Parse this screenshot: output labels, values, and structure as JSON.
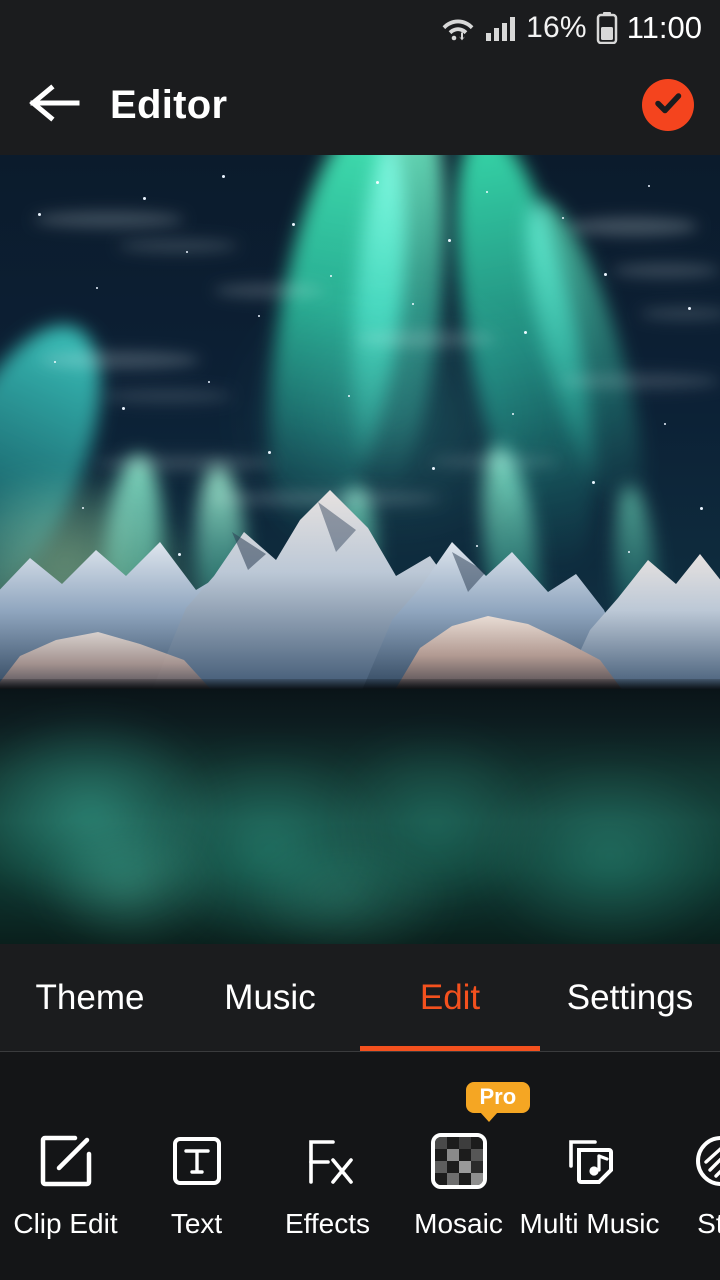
{
  "status_bar": {
    "wifi_icon": "wifi-arrows-icon",
    "signal_icon": "cellular-signal-icon",
    "battery_percent": "16%",
    "battery_icon": "battery-icon",
    "clock": "11:00"
  },
  "app_bar": {
    "back_icon": "arrow-left-icon",
    "title": "Editor",
    "done_icon": "check-circle-icon",
    "done_color": "#f4441e"
  },
  "preview": {
    "scene": "aurora-borealis-over-snowy-mountains-and-lake"
  },
  "tabs": {
    "active_color": "#f4511e",
    "items": [
      {
        "label": "Theme",
        "active": false
      },
      {
        "label": "Music",
        "active": false
      },
      {
        "label": "Edit",
        "active": true
      },
      {
        "label": "Settings",
        "active": false
      }
    ]
  },
  "tools": {
    "items": [
      {
        "label": "Clip Edit",
        "icon": "square-pencil-icon",
        "badge": null
      },
      {
        "label": "Text",
        "icon": "text-box-icon",
        "badge": null
      },
      {
        "label": "Effects",
        "icon": "fx-icon",
        "badge": null
      },
      {
        "label": "Mosaic",
        "icon": "mosaic-grid-icon",
        "badge": "Pro"
      },
      {
        "label": "Multi Music",
        "icon": "music-stack-icon",
        "badge": null
      },
      {
        "label": "Stic",
        "icon": "sticker-circle-icon",
        "badge": null
      }
    ],
    "badge_color": "#f5a623"
  }
}
